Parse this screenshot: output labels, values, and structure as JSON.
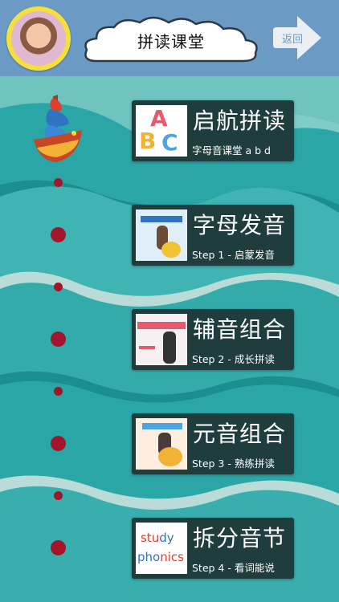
{
  "header": {
    "title": "拼读课堂",
    "back_label": "返回",
    "colors": {
      "bar": "#6b9ac4",
      "avatar_ring": "#f4e13a"
    }
  },
  "path": {
    "dot_color": "#a3152b"
  },
  "lessons": [
    {
      "title": "启航拼读",
      "subtitle": "字母音课堂 a b d",
      "thumb": "abc-blocks-icon"
    },
    {
      "title": "字母发音",
      "subtitle": "Step 1 - 启蒙发音",
      "thumb": "letter-sound-video-thumb"
    },
    {
      "title": "辅音组合",
      "subtitle": "Step 2 - 成长拼读",
      "thumb": "consonant-team-video-thumb"
    },
    {
      "title": "元音组合",
      "subtitle": "Step 3 - 熟练拼读",
      "thumb": "vowel-team-video-thumb"
    },
    {
      "title": "拆分音节",
      "subtitle": "Step 4 - 看词能说",
      "thumb": "study-phonics-thumb"
    }
  ],
  "thumb_text": {
    "abc": [
      "A",
      "B",
      "C"
    ],
    "phonics": [
      "stu",
      "dy",
      "pho",
      "nics"
    ]
  }
}
